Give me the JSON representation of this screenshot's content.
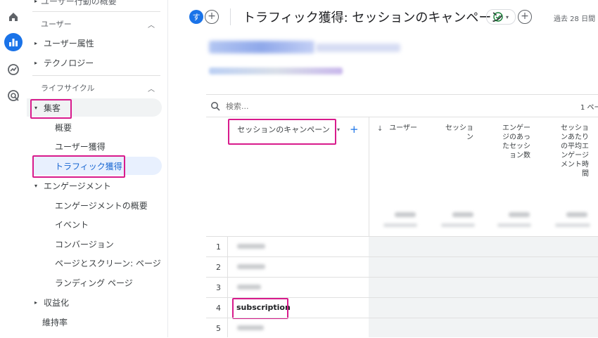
{
  "rail": {
    "icons": [
      "home-icon",
      "reports-icon",
      "explore-icon",
      "advertising-icon"
    ]
  },
  "sidebar": {
    "top_cut_label": "ユーザー行動の概要",
    "user_section": "ユーザー",
    "user_items": [
      "ユーザー属性",
      "テクノロジー"
    ],
    "lifecycle_section": "ライフサイクル",
    "acquisition": "集客",
    "acquisition_items": [
      "概要",
      "ユーザー獲得",
      "トラフィック獲得"
    ],
    "engagement": "エンゲージメント",
    "engagement_items": [
      "エンゲージメントの概要",
      "イベント",
      "コンバージョン",
      "ページとスクリーン: ページ...",
      "ランディング ページ"
    ],
    "monetization": "収益化",
    "retention": "維持率"
  },
  "header": {
    "avatar_letter": "す",
    "title": "トラフィック獲得: セッションのキャンペーン",
    "date_range": "過去 28 日間"
  },
  "table": {
    "search_placeholder": "検索...",
    "pagination": "1 ペー",
    "dimension_header": "セッションのキャンペーン",
    "columns": [
      "ユーザー",
      "セッション",
      "エンゲージのあったセッション数",
      "セッションあたりの平均エンゲージメント時間"
    ],
    "rows": [
      {
        "rank": "1"
      },
      {
        "rank": "2"
      },
      {
        "rank": "3"
      },
      {
        "rank": "4",
        "campaign": "subscription"
      },
      {
        "rank": "5"
      }
    ]
  },
  "colors": {
    "accent": "#1a73e8",
    "highlight": "#d81b8c",
    "selected_bg": "#e8f0fe"
  }
}
